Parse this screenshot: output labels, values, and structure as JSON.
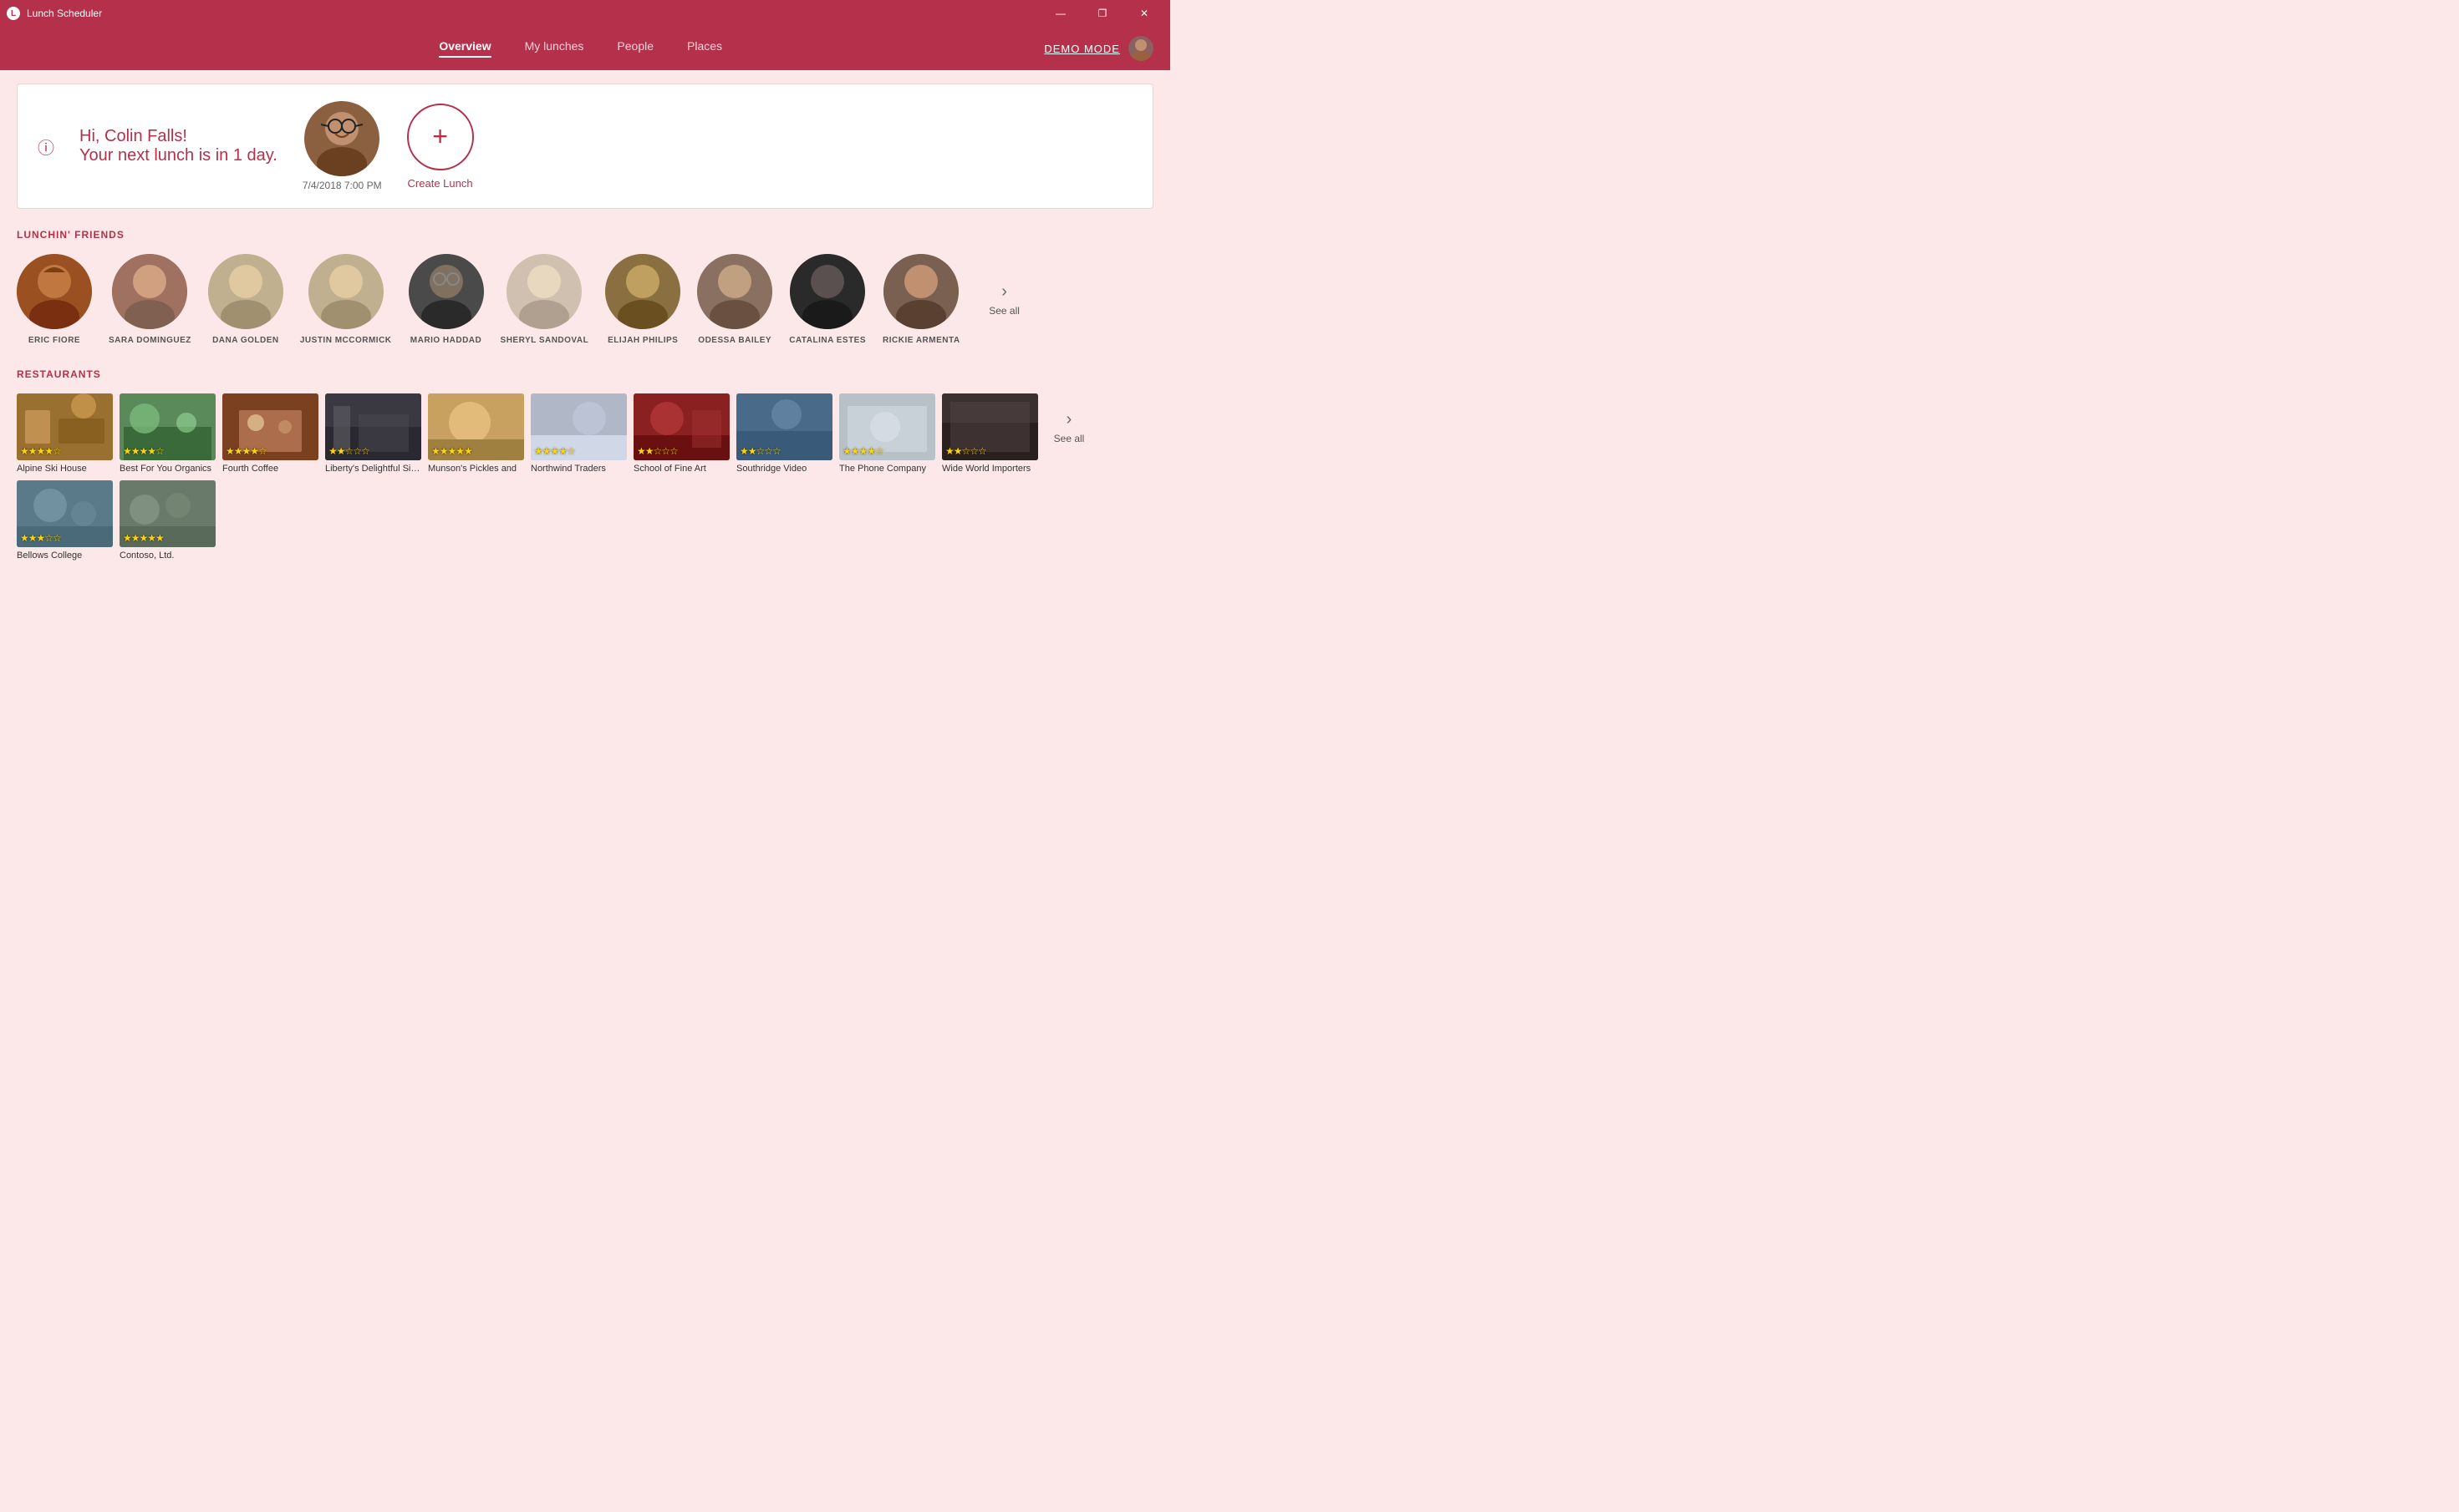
{
  "app": {
    "title": "Lunch Scheduler"
  },
  "titlebar": {
    "title": "Lunch Scheduler",
    "minimize": "—",
    "restore": "❐",
    "close": "✕"
  },
  "nav": {
    "tabs": [
      {
        "id": "overview",
        "label": "Overview",
        "active": true
      },
      {
        "id": "my-lunches",
        "label": "My lunches",
        "active": false
      },
      {
        "id": "people",
        "label": "People",
        "active": false
      },
      {
        "id": "places",
        "label": "Places",
        "active": false
      }
    ],
    "demo_mode": "DEMO MODE"
  },
  "greeting": {
    "hi": "Hi, Colin Falls!",
    "next_lunch": "Your next lunch is in 1 day.",
    "date": "7/4/2018 7:00 PM",
    "create_label": "Create Lunch"
  },
  "friends": {
    "section_title": "LUNCHIN' FRIENDS",
    "see_all": "See all",
    "items": [
      {
        "name": "ERIC FIORE",
        "av_class": "av1"
      },
      {
        "name": "SARA DOMINGUEZ",
        "av_class": "av2"
      },
      {
        "name": "DANA GOLDEN",
        "av_class": "av3"
      },
      {
        "name": "JUSTIN MCCORMICK",
        "av_class": "av4"
      },
      {
        "name": "MARIO HADDAD",
        "av_class": "av5"
      },
      {
        "name": "SHERYL SANDOVAL",
        "av_class": "av6"
      },
      {
        "name": "ELIJAH PHILIPS",
        "av_class": "av7"
      },
      {
        "name": "ODESSA BAILEY",
        "av_class": "av8"
      },
      {
        "name": "CATALINA ESTES",
        "av_class": "av9"
      },
      {
        "name": "RICKIE ARMENTA",
        "av_class": "av10"
      }
    ]
  },
  "restaurants": {
    "section_title": "RESTAURANTS",
    "see_all": "See all",
    "row1": [
      {
        "name": "Alpine Ski House",
        "stars": "★★★★☆",
        "img_class": "rest-alpine"
      },
      {
        "name": "Best For You Organics",
        "stars": "★★★★☆",
        "img_class": "rest-best"
      },
      {
        "name": "Fourth Coffee",
        "stars": "★★★★☆",
        "img_class": "rest-fourth"
      },
      {
        "name": "Liberty's Delightful Sinful",
        "stars": "★★☆☆☆",
        "img_class": "rest-liberty"
      },
      {
        "name": "Munson's Pickles and",
        "stars": "★★★★★",
        "img_class": "rest-munson"
      },
      {
        "name": "Northwind Traders",
        "stars": "★★★★☆",
        "img_class": "rest-northwind"
      },
      {
        "name": "School of Fine Art",
        "stars": "★★☆☆☆",
        "img_class": "rest-school"
      },
      {
        "name": "Southridge Video",
        "stars": "★★☆☆☆",
        "img_class": "rest-southridge"
      },
      {
        "name": "The Phone Company",
        "stars": "★★★★☆",
        "img_class": "rest-phone"
      },
      {
        "name": "Wide World Importers",
        "stars": "★★☆☆☆",
        "img_class": "rest-wide"
      }
    ],
    "row2": [
      {
        "name": "Bellows College",
        "stars": "★★★☆☆",
        "img_class": "rest-bellows"
      },
      {
        "name": "Contoso, Ltd.",
        "stars": "★★★★★",
        "img_class": "rest-contoso"
      }
    ]
  }
}
